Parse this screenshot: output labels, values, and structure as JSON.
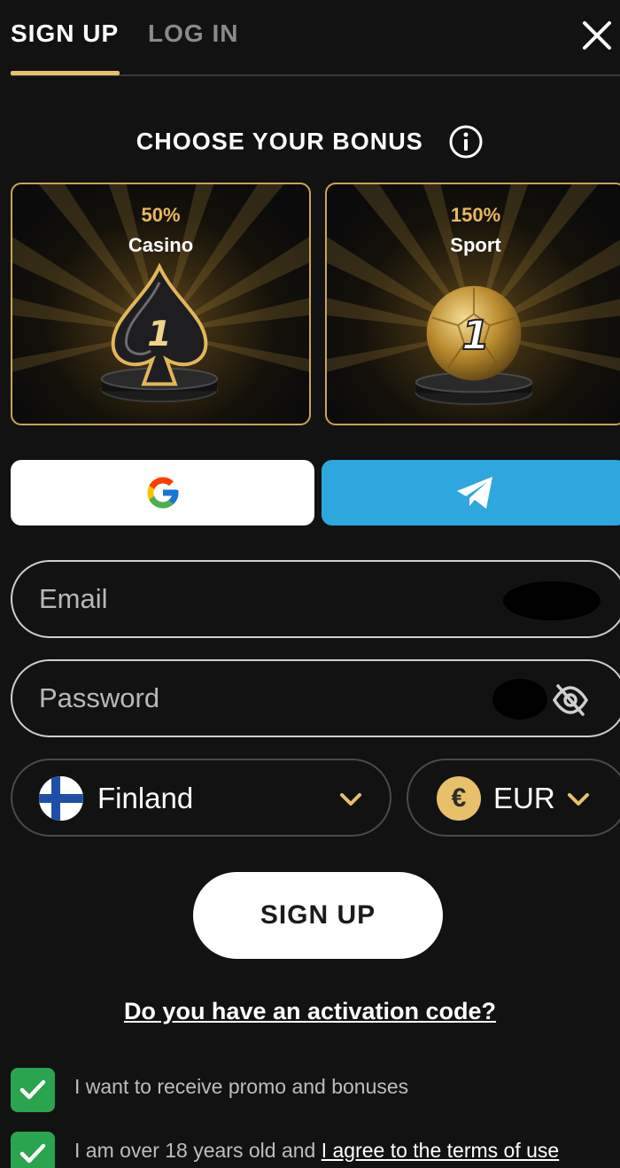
{
  "tabs": {
    "signup": "SIGN UP",
    "login": "LOG IN"
  },
  "bonus": {
    "title": "CHOOSE YOUR BONUS",
    "cards": [
      {
        "percent": "50%",
        "label": "Casino",
        "badge": "1"
      },
      {
        "percent": "150%",
        "label": "Sport",
        "badge": "1"
      }
    ]
  },
  "form": {
    "email_placeholder": "Email",
    "password_placeholder": "Password",
    "country": "Finland",
    "currency": "EUR",
    "currency_symbol": "€",
    "submit_label": "SIGN UP",
    "activation_link": "Do you have an activation code?"
  },
  "consents": {
    "promo": "I want to receive promo and bonuses",
    "age_prefix": "I am over 18 years old and ",
    "terms_link": "I agree to the terms of use"
  },
  "colors": {
    "accent_gold": "#e8c06a",
    "telegram_blue": "#2ea6de",
    "check_green": "#2aa44f",
    "background": "#121212"
  }
}
